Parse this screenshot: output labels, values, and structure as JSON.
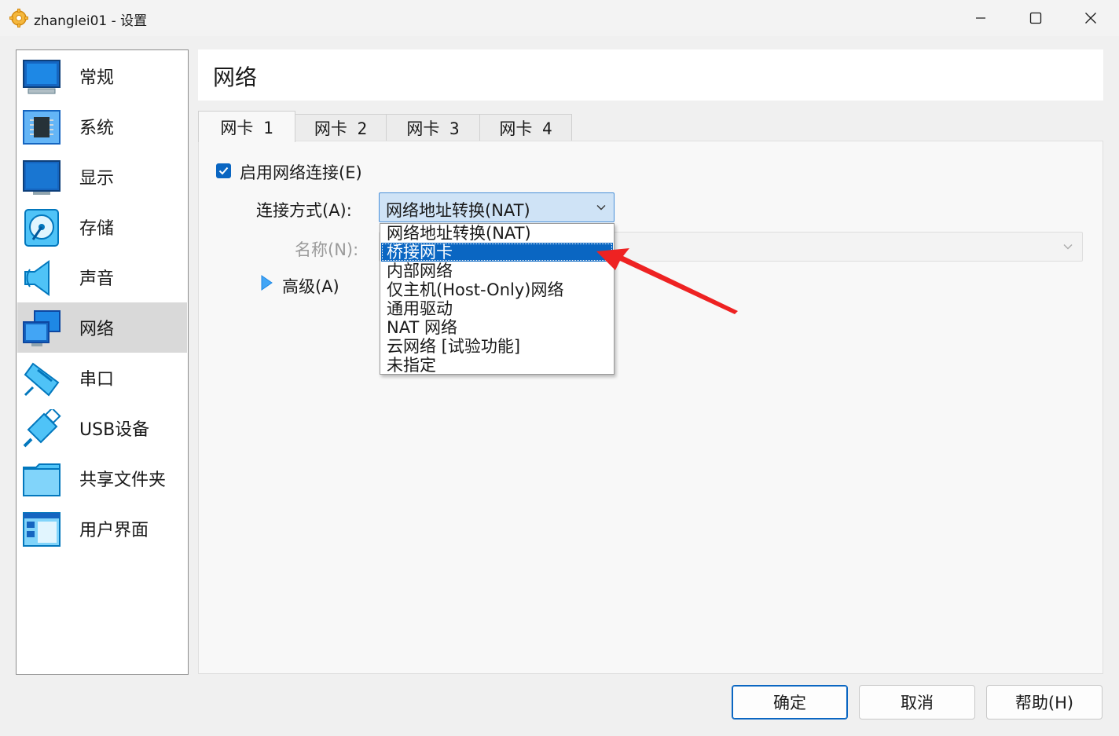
{
  "window": {
    "title": "zhanglei01 - 设置",
    "icons": {
      "app": "gear-icon",
      "minimize": "minimize-icon",
      "maximize": "maximize-icon",
      "close": "close-icon"
    }
  },
  "sidebar": {
    "items": [
      {
        "label": "常规",
        "icon": "monitor-icon"
      },
      {
        "label": "系统",
        "icon": "chip-icon"
      },
      {
        "label": "显示",
        "icon": "display-icon"
      },
      {
        "label": "存储",
        "icon": "disk-icon"
      },
      {
        "label": "声音",
        "icon": "speaker-icon"
      },
      {
        "label": "网络",
        "icon": "network-icon",
        "selected": true
      },
      {
        "label": "串口",
        "icon": "serial-port-icon"
      },
      {
        "label": "USB设备",
        "icon": "usb-icon"
      },
      {
        "label": "共享文件夹",
        "icon": "folder-icon"
      },
      {
        "label": "用户界面",
        "icon": "user-interface-icon"
      }
    ]
  },
  "header": {
    "title": "网络"
  },
  "tabs": [
    {
      "label": "网卡 1",
      "active": true
    },
    {
      "label": "网卡 2"
    },
    {
      "label": "网卡 3"
    },
    {
      "label": "网卡 4"
    }
  ],
  "form": {
    "enable_label": "启用网络连接(E)",
    "enable_checked": true,
    "connection_label": "连接方式(A):",
    "connection_value": "网络地址转换(NAT)",
    "name_label": "名称(N):",
    "name_value": "",
    "advanced_label": "高级(A)"
  },
  "dropdown": {
    "options": [
      "网络地址转换(NAT)",
      "桥接网卡",
      "内部网络",
      "仅主机(Host-Only)网络",
      "通用驱动",
      "NAT 网络",
      "云网络 [试验功能]",
      "未指定"
    ],
    "highlighted_index": 1
  },
  "buttons": {
    "ok": "确定",
    "cancel": "取消",
    "help": "帮助(H)"
  },
  "colors": {
    "accent": "#0a66c2",
    "annotation_arrow": "#ee2222"
  }
}
